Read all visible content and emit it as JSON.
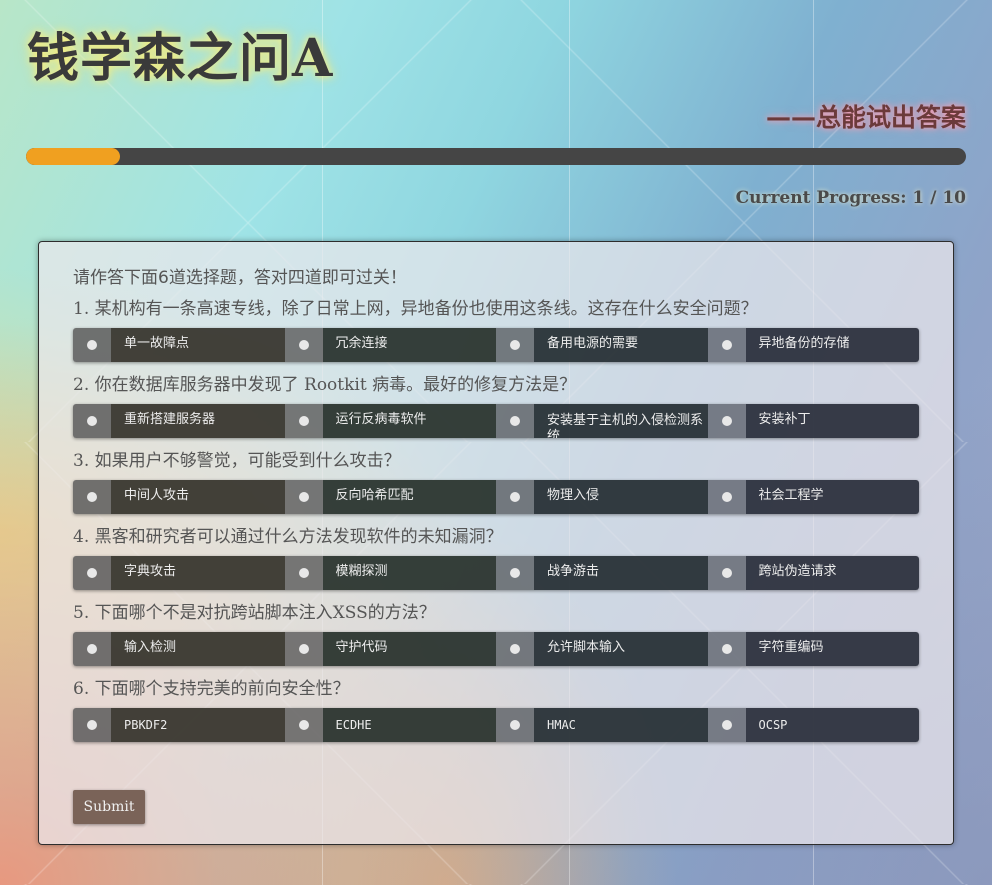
{
  "header": {
    "title": "钱学森之问A",
    "subtitle": "——总能试出答案"
  },
  "progress": {
    "label": "Current Progress:",
    "current": 1,
    "total": 10,
    "separator": "/",
    "fill_fraction": 0.1,
    "fill_color": "#f0a020"
  },
  "quiz": {
    "intro": "请作答下面6道选择题，答对四道即可过关！",
    "questions": [
      {
        "text": "1. 某机构有一条高速专线，除了日常上网，异地备份也使用这条线。这存在什么安全问题？",
        "options": [
          "单一故障点",
          "冗余连接",
          "备用电源的需要",
          "异地备份的存储"
        ]
      },
      {
        "text": "2. 你在数据库服务器中发现了 Rootkit 病毒。最好的修复方法是？",
        "options": [
          "重新搭建服务器",
          "运行反病毒软件",
          "安装基于主机的入侵检测系统",
          "安装补丁"
        ]
      },
      {
        "text": "3. 如果用户不够警觉，可能受到什么攻击？",
        "options": [
          "中间人攻击",
          "反向哈希匹配",
          "物理入侵",
          "社会工程学"
        ]
      },
      {
        "text": "4. 黑客和研究者可以通过什么方法发现软件的未知漏洞？",
        "options": [
          "字典攻击",
          "模糊探测",
          "战争游击",
          "跨站伪造请求"
        ]
      },
      {
        "text": "5. 下面哪个不是对抗跨站脚本注入XSS的方法？",
        "options": [
          "输入检测",
          "守护代码",
          "允许脚本输入",
          "字符重编码"
        ]
      },
      {
        "text": "6. 下面哪个支持完美的前向安全性？",
        "options": [
          "PBKDF2",
          "ECDHE",
          "HMAC",
          "OCSP"
        ]
      }
    ],
    "submit_label": "Submit"
  }
}
